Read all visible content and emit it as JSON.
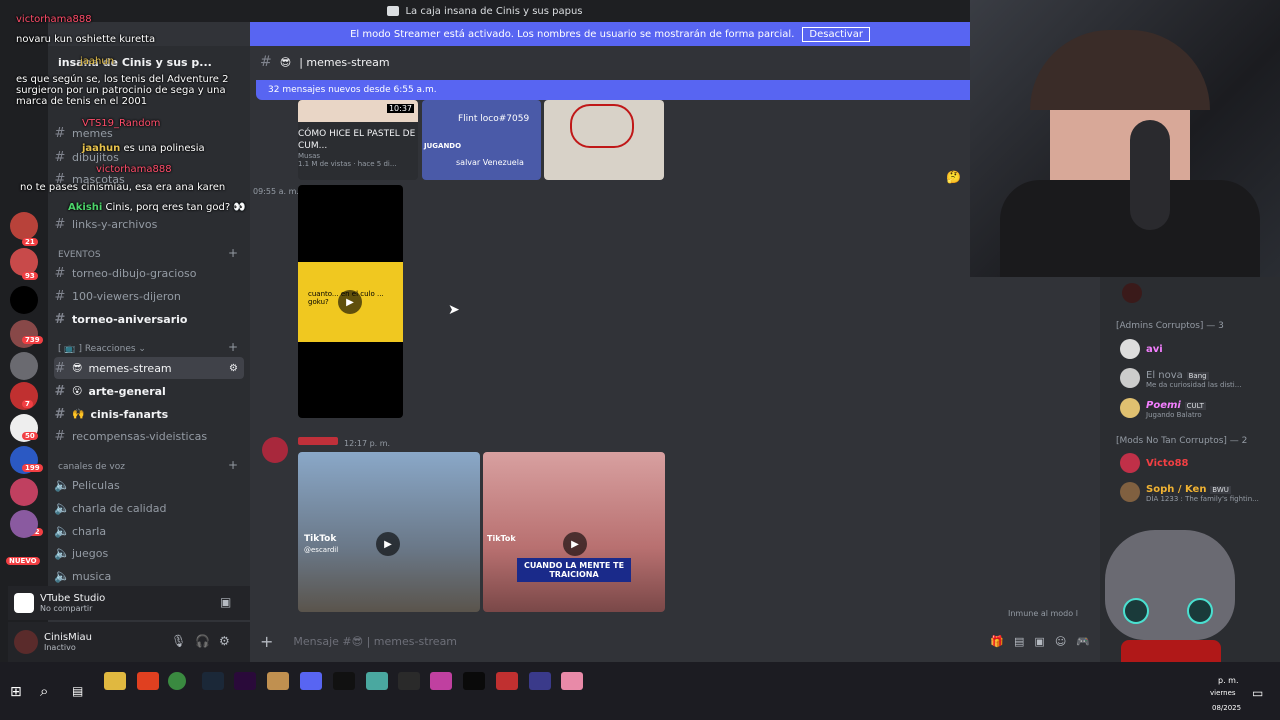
{
  "window": {
    "title": "La caja insana de Cinis y sus papus"
  },
  "streamer_banner": {
    "text": "El modo Streamer está activado. Los nombres de usuario se mostrarán de forma parcial.",
    "button": "Desactivar"
  },
  "server": {
    "name": "insana de Cinis y sus p..."
  },
  "rail_badges": [
    "21",
    "93",
    "739",
    "7",
    "50",
    "199",
    "112",
    "NUEVO"
  ],
  "channels": {
    "top_items": [
      "memes",
      "dibujitos",
      "mascotas",
      "links-y-archivos"
    ],
    "category_eventos": "EVENTOS",
    "eventos": [
      "torneo-dibujo-gracioso",
      "100-viewers-dijeron",
      "torneo-aniversario"
    ],
    "category_reacciones": "Reacciones",
    "reacciones": [
      "memes-stream",
      "arte-general",
      "cinis-fanarts",
      "recompensas-videisticas"
    ],
    "category_voz": "canales de voz",
    "voz": [
      "Peliculas",
      "charla de calidad",
      "charla",
      "juegos",
      "musica"
    ]
  },
  "vtube": {
    "name": "VTube Studio",
    "status": "No compartir"
  },
  "user": {
    "name": "CinisMiau",
    "status": "Inactivo"
  },
  "chat_overlay": [
    {
      "name": "victorhama888",
      "text": ""
    },
    {
      "name": "",
      "text": "novaru kun oshiette kuretta"
    },
    {
      "name": "jaahun",
      "text": ""
    },
    {
      "name": "",
      "text": "es que según se, los tenis del Adventure 2 surgieron por un patrocinio de sega y una marca de tenis en el 2001"
    },
    {
      "name": "VTS19_Random",
      "text": ""
    },
    {
      "name": "jaahun",
      "text": "es una polinesia"
    },
    {
      "name": "victorhama888",
      "text": ""
    },
    {
      "name": "",
      "text": "no te pases cinismiau, esa era ana karen"
    },
    {
      "name": "Akishi",
      "text": "Cinis, porq eres tan god? 👀"
    }
  ],
  "channel_header": {
    "name": "memes-stream"
  },
  "new_messages": {
    "text": "32 mensajes nuevos desde 6:55 a.m."
  },
  "messages": {
    "embed1": {
      "duration": "10:37",
      "title": "CÓMO HICE EL PASTEL DE CUM...",
      "channel": "Musas",
      "meta": "1.1 M de vistas · hace 5 di..."
    },
    "embed2": {
      "title": "Flint loco#7059",
      "label": "JUGANDO",
      "game": "salvar Venezuela"
    },
    "time1": "09:55 a. m.",
    "video1_caption": "cuanto... en el culo ... goku?",
    "msg2_time": "12:17 p. m.",
    "tiktok1": {
      "brand": "TikTok",
      "handle": "@escardil"
    },
    "tiktok2": {
      "brand": "TikTok",
      "caption": "CUANDO LA MENTE TE TRAICIONA"
    }
  },
  "composer": {
    "placeholder": "Mensaje #😎 | memes-stream"
  },
  "members": {
    "admins_cat": "[Admins Corruptos] — 3",
    "admins": [
      {
        "name": "avi",
        "activity": "",
        "color": "#f47fff"
      },
      {
        "name": "El nova",
        "tag": "Bang",
        "activity": "Me da curiosidad las disti...",
        "color": "#949ba4"
      },
      {
        "name": "Poemi",
        "tag": "CULT",
        "activity": "Jugando Balatro",
        "color": "#f47fff"
      }
    ],
    "mods_cat": "[Mods No Tan Corruptos] — 2",
    "mods": [
      {
        "name": "Victo88",
        "activity": "",
        "color": "#f23f43"
      },
      {
        "name": "Soph / Ken",
        "tag": "BWU",
        "activity": "DÍA 1233 : The family's fightin...",
        "color": "#f0b232"
      }
    ],
    "immune": "Inmune al modo l"
  },
  "taskbar": {
    "time": "p. m.",
    "day": "viernes",
    "date": "08/2025"
  }
}
